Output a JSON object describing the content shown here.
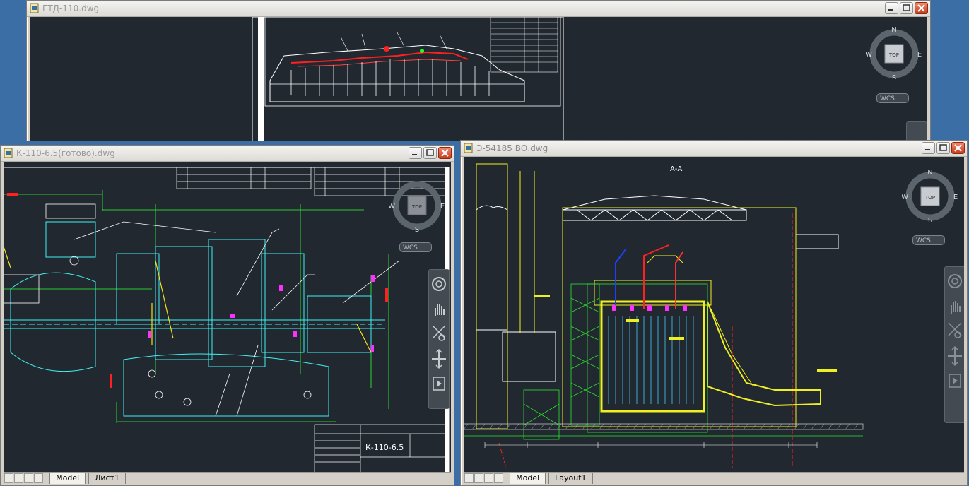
{
  "windows": {
    "gtd": {
      "title": "ГТД-110.dwg"
    },
    "k110": {
      "title": "К-110-6.5(готово).dwg",
      "tabs": [
        "Model",
        "Лист1"
      ],
      "stamp_label": "К-110-6.5"
    },
    "e54185": {
      "title": "Э-54185 ВО.dwg",
      "tabs": [
        "Model",
        "Layout1"
      ],
      "section_label": "А-А"
    }
  },
  "viewcube": {
    "top_label": "TOP",
    "north": "N",
    "south": "S",
    "east": "E",
    "west": "W",
    "wcs_label": "WCS"
  },
  "icons": [
    "document-icon",
    "minimize-icon",
    "maximize-icon",
    "close-icon",
    "steering-wheel-icon",
    "pan-icon",
    "zoom-icon",
    "orbit-icon",
    "showmotion-icon"
  ],
  "colors": {
    "desktop": "#3a6ea5",
    "model_space": "#212830",
    "titlebar_text": "#9a9a9a"
  }
}
